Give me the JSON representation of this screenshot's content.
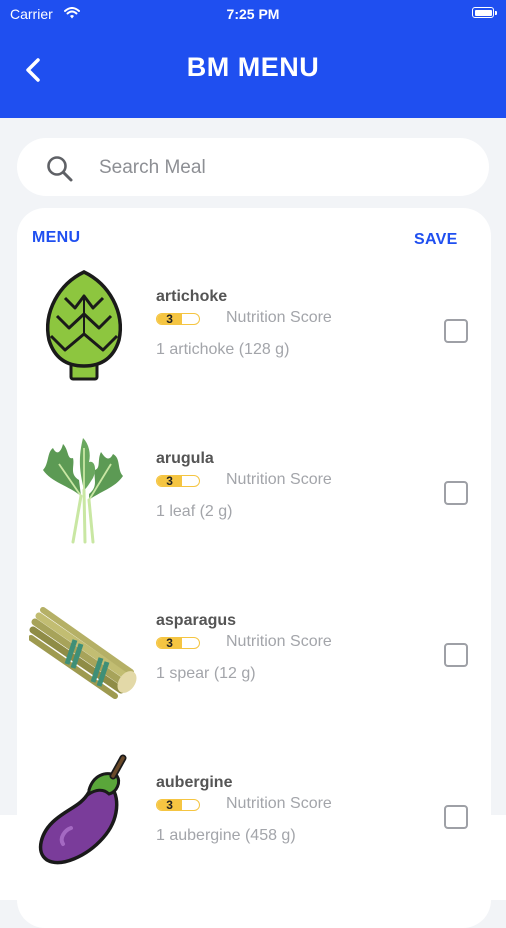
{
  "status_bar": {
    "carrier": "Carrier",
    "time": "7:25 PM"
  },
  "header": {
    "title": "BM MENU",
    "back_icon": "chevron-left-icon"
  },
  "search": {
    "placeholder": "Search Meal",
    "value": "",
    "icon": "search-icon"
  },
  "menu": {
    "label": "MENU",
    "save_label": "SAVE",
    "items": [
      {
        "name": "artichoke",
        "score": "3",
        "score_fraction": 0.6,
        "score_caption": "Nutrition Score",
        "serving": "1 artichoke (128 g)",
        "checked": false,
        "image": "artichoke-image"
      },
      {
        "name": "arugula",
        "score": "3",
        "score_fraction": 0.6,
        "score_caption": "Nutrition Score",
        "serving": "1 leaf (2 g)",
        "checked": false,
        "image": "arugula-image"
      },
      {
        "name": "asparagus",
        "score": "3",
        "score_fraction": 0.6,
        "score_caption": "Nutrition Score",
        "serving": "1 spear (12 g)",
        "checked": false,
        "image": "asparagus-image"
      },
      {
        "name": "aubergine",
        "score": "3",
        "score_fraction": 0.6,
        "score_caption": "Nutrition Score",
        "serving": "1 aubergine (458 g)",
        "checked": false,
        "image": "aubergine-image"
      }
    ]
  },
  "colors": {
    "primary": "#1f4ff0",
    "score": "#f5c542",
    "background": "#f2f4f7"
  }
}
